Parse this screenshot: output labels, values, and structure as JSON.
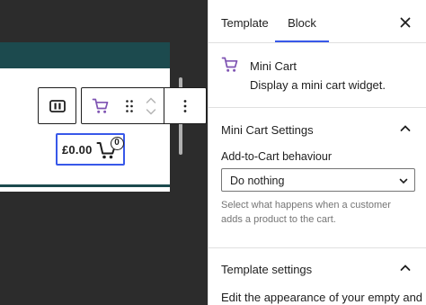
{
  "canvas": {
    "mini_cart": {
      "total": "£0.00",
      "count": "0"
    }
  },
  "colors": {
    "accent": "#3858e9",
    "woo_purple": "#7f54b3",
    "teal": "#1c4a4e",
    "canvas_bg": "#2c2c2c"
  },
  "toolbar": {
    "icons": [
      "block-parent-icon",
      "cart-icon",
      "drag-handle-icon",
      "move-up-icon",
      "move-down-icon",
      "more-options-icon"
    ]
  },
  "sidebar": {
    "tabs": [
      {
        "label": "Template"
      },
      {
        "label": "Block",
        "active": true
      }
    ],
    "block_card": {
      "title": "Mini Cart",
      "description": "Display a mini cart widget."
    },
    "mini_cart_settings": {
      "title": "Mini Cart Settings",
      "add_to_cart_label": "Add-to-Cart behaviour",
      "add_to_cart_value": "Do nothing",
      "help": "Select what happens when a customer adds a product to the cart."
    },
    "template_settings": {
      "title": "Template settings",
      "text": "Edit the appearance of your empty and"
    }
  }
}
